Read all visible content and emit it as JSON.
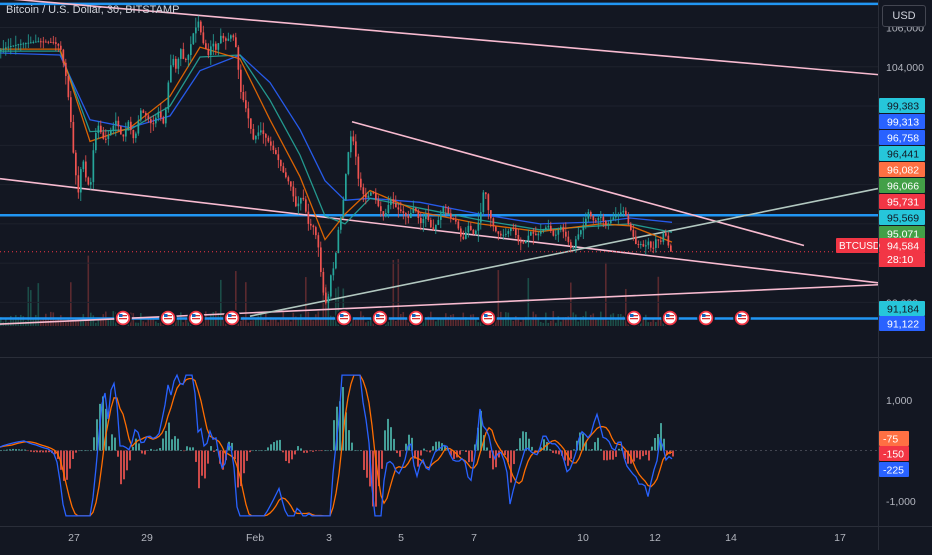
{
  "title": "Bitcoin / U.S. Dollar, 30, BITSTAMP",
  "currency_button": "USD",
  "colors": {
    "background": "#131722",
    "up": "#26a69a",
    "down": "#ef5350",
    "level_line": "#2196f3",
    "trend_line": "#f8bbd0",
    "ema_fast": "#ef6c00",
    "ema_slow": "#2962ff",
    "ema_mid": "#26a69a"
  },
  "chart_data": [
    {
      "type": "candlestick",
      "symbol": "BTCUSD",
      "title": "Bitcoin / U.S. Dollar, 30, BITSTAMP",
      "ylim": [
        90800,
        107400
      ],
      "y_ticks": [
        "106,000",
        "104,000",
        "92,000"
      ],
      "x_ticks": [
        "27",
        "29",
        "Feb",
        "3",
        "5",
        "7",
        "10",
        "12",
        "14",
        "17"
      ],
      "price_path": [
        [
          0,
          104800
        ],
        [
          8,
          105000
        ],
        [
          20,
          105150
        ],
        [
          40,
          105300
        ],
        [
          55,
          105250
        ],
        [
          62,
          105000
        ],
        [
          68,
          103400
        ],
        [
          72,
          101500
        ],
        [
          76,
          99000
        ],
        [
          80,
          97600
        ],
        [
          84,
          99500
        ],
        [
          88,
          98200
        ],
        [
          92,
          97800
        ],
        [
          96,
          100400
        ],
        [
          100,
          101000
        ],
        [
          106,
          100200
        ],
        [
          112,
          100700
        ],
        [
          118,
          101300
        ],
        [
          124,
          100300
        ],
        [
          130,
          101200
        ],
        [
          136,
          100200
        ],
        [
          142,
          101800
        ],
        [
          148,
          101500
        ],
        [
          154,
          101000
        ],
        [
          160,
          101700
        ],
        [
          166,
          101000
        ],
        [
          170,
          103200
        ],
        [
          174,
          104600
        ],
        [
          178,
          103800
        ],
        [
          182,
          105000
        ],
        [
          186,
          104200
        ],
        [
          190,
          104600
        ],
        [
          195,
          105700
        ],
        [
          200,
          106300
        ],
        [
          205,
          105200
        ],
        [
          210,
          104600
        ],
        [
          214,
          105300
        ],
        [
          218,
          104800
        ],
        [
          222,
          105600
        ],
        [
          228,
          105300
        ],
        [
          234,
          105700
        ],
        [
          238,
          104900
        ],
        [
          242,
          102800
        ],
        [
          248,
          101800
        ],
        [
          255,
          100300
        ],
        [
          262,
          100800
        ],
        [
          270,
          100200
        ],
        [
          278,
          99500
        ],
        [
          286,
          98500
        ],
        [
          292,
          98000
        ],
        [
          298,
          96800
        ],
        [
          304,
          97500
        ],
        [
          310,
          96000
        ],
        [
          316,
          95800
        ],
        [
          320,
          94800
        ],
        [
          324,
          92800
        ],
        [
          327,
          91900
        ],
        [
          330,
          92300
        ],
        [
          333,
          93600
        ],
        [
          336,
          93800
        ],
        [
          340,
          95700
        ],
        [
          344,
          96700
        ],
        [
          348,
          98800
        ],
        [
          352,
          100500
        ],
        [
          356,
          100100
        ],
        [
          360,
          98300
        ],
        [
          364,
          97600
        ],
        [
          368,
          97300
        ],
        [
          374,
          97700
        ],
        [
          380,
          96900
        ],
        [
          386,
          96300
        ],
        [
          392,
          97300
        ],
        [
          398,
          96800
        ],
        [
          404,
          96600
        ],
        [
          410,
          96300
        ],
        [
          416,
          96900
        ],
        [
          422,
          96000
        ],
        [
          428,
          96500
        ],
        [
          434,
          95600
        ],
        [
          440,
          96200
        ],
        [
          446,
          97000
        ],
        [
          452,
          96300
        ],
        [
          458,
          96100
        ],
        [
          464,
          95100
        ],
        [
          470,
          95900
        ],
        [
          476,
          95400
        ],
        [
          482,
          96400
        ],
        [
          486,
          98000
        ],
        [
          490,
          96700
        ],
        [
          496,
          95700
        ],
        [
          502,
          95400
        ],
        [
          508,
          95500
        ],
        [
          514,
          95900
        ],
        [
          520,
          95100
        ],
        [
          526,
          95000
        ],
        [
          532,
          95600
        ],
        [
          538,
          95400
        ],
        [
          544,
          95700
        ],
        [
          550,
          95900
        ],
        [
          556,
          95300
        ],
        [
          562,
          95900
        ],
        [
          568,
          95300
        ],
        [
          574,
          94600
        ],
        [
          578,
          95300
        ],
        [
          584,
          95800
        ],
        [
          590,
          96600
        ],
        [
          596,
          96100
        ],
        [
          602,
          96400
        ],
        [
          608,
          95900
        ],
        [
          614,
          96300
        ],
        [
          620,
          96500
        ],
        [
          626,
          96700
        ],
        [
          630,
          96000
        ],
        [
          634,
          95500
        ],
        [
          638,
          94900
        ],
        [
          642,
          95000
        ],
        [
          646,
          94800
        ],
        [
          650,
          95100
        ],
        [
          654,
          94600
        ],
        [
          658,
          95300
        ],
        [
          662,
          95000
        ],
        [
          666,
          95700
        ],
        [
          670,
          94900
        ],
        [
          672,
          94584
        ]
      ],
      "ema_fast": [
        [
          0,
          104900
        ],
        [
          60,
          104900
        ],
        [
          90,
          100200
        ],
        [
          130,
          100900
        ],
        [
          170,
          102500
        ],
        [
          200,
          105000
        ],
        [
          240,
          104400
        ],
        [
          270,
          101300
        ],
        [
          300,
          98400
        ],
        [
          325,
          95200
        ],
        [
          345,
          96500
        ],
        [
          370,
          97700
        ],
        [
          420,
          96600
        ],
        [
          480,
          96000
        ],
        [
          540,
          95600
        ],
        [
          600,
          96000
        ],
        [
          630,
          95900
        ],
        [
          672,
          95071
        ]
      ],
      "ema_mid": [
        [
          0,
          104800
        ],
        [
          60,
          104800
        ],
        [
          90,
          100700
        ],
        [
          130,
          100800
        ],
        [
          170,
          102000
        ],
        [
          200,
          104500
        ],
        [
          240,
          104600
        ],
        [
          270,
          102300
        ],
        [
          300,
          99500
        ],
        [
          325,
          96400
        ],
        [
          345,
          96000
        ],
        [
          370,
          97300
        ],
        [
          420,
          96800
        ],
        [
          480,
          96200
        ],
        [
          540,
          95700
        ],
        [
          600,
          95900
        ],
        [
          630,
          96000
        ],
        [
          672,
          95569
        ]
      ],
      "ema_slow": [
        [
          0,
          104700
        ],
        [
          60,
          104600
        ],
        [
          90,
          101300
        ],
        [
          130,
          100900
        ],
        [
          170,
          101500
        ],
        [
          200,
          103800
        ],
        [
          240,
          104600
        ],
        [
          270,
          103200
        ],
        [
          300,
          100800
        ],
        [
          325,
          98200
        ],
        [
          345,
          97200
        ],
        [
          370,
          97300
        ],
        [
          420,
          97100
        ],
        [
          480,
          96500
        ],
        [
          540,
          96000
        ],
        [
          600,
          96100
        ],
        [
          630,
          96300
        ],
        [
          672,
          96082
        ]
      ],
      "horizontal_levels": [
        107200,
        96441,
        91184
      ],
      "trend_lines": [
        {
          "from": [
            0,
            107500
          ],
          "to": [
            878,
            103600
          ]
        },
        {
          "from": [
            352,
            101200
          ],
          "to": [
            804,
            94900
          ]
        },
        {
          "from": [
            0,
            98300
          ],
          "to": [
            878,
            93000
          ]
        },
        {
          "from": [
            0,
            90900
          ],
          "to": [
            878,
            92900
          ]
        },
        {
          "from": [
            250,
            91300
          ],
          "to": [
            878,
            97800
          ]
        }
      ],
      "price_labels": [
        {
          "value": "99,383",
          "color": "#26c6da",
          "text_color": "#131722"
        },
        {
          "value": "99,313",
          "color": "#2962ff",
          "text_color": "#ffffff"
        },
        {
          "value": "96,758",
          "color": "#2962ff",
          "text_color": "#ffffff"
        },
        {
          "value": "96,441",
          "color": "#26c6da",
          "text_color": "#131722"
        },
        {
          "value": "96,082",
          "color": "#ff7043",
          "text_color": "#ffffff"
        },
        {
          "value": "96,066",
          "color": "#43a047",
          "text_color": "#ffffff"
        },
        {
          "value": "95,731",
          "color": "#f23645",
          "text_color": "#ffffff"
        },
        {
          "value": "95,569",
          "color": "#26c6da",
          "text_color": "#131722"
        },
        {
          "value": "95,071",
          "color": "#43a047",
          "text_color": "#ffffff"
        },
        {
          "value": "94,584",
          "color": "#f23645",
          "text_color": "#ffffff"
        },
        {
          "value": "91,184",
          "color": "#26c6da",
          "text_color": "#131722"
        },
        {
          "value": "91,122",
          "color": "#2962ff",
          "text_color": "#ffffff"
        }
      ],
      "last_price_tag": {
        "symbol": "BTCUSD",
        "price": "94,584",
        "countdown": "28:10"
      },
      "event_markers": [
        123,
        168,
        196,
        232,
        344,
        380,
        416,
        488,
        634,
        670,
        706,
        742
      ]
    },
    {
      "type": "oscillator",
      "ylim": [
        -1500,
        1800
      ],
      "y_ticks": [
        "1,000",
        "-1,000"
      ],
      "value_labels": [
        {
          "value": "-75",
          "color": "#ff7043"
        },
        {
          "value": "-150",
          "color": "#f23645"
        },
        {
          "value": "-225",
          "color": "#2962ff"
        }
      ]
    }
  ]
}
